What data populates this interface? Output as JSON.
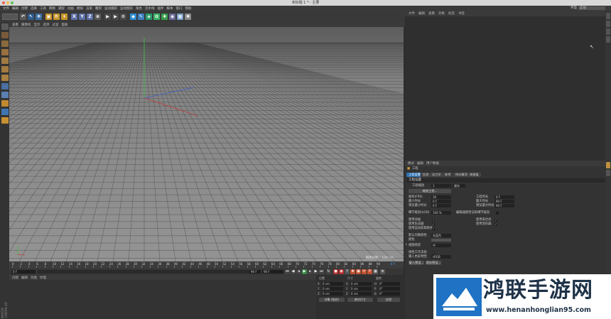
{
  "window": {
    "title": "未标题 1 * - 主要"
  },
  "menu": {
    "items": [
      "文件",
      "编辑",
      "创建",
      "选择",
      "工具",
      "网格",
      "捕捉",
      "动画",
      "模拟",
      "渲染",
      "雕刻",
      "运动跟踪",
      "运动图形",
      "角色",
      "流水线",
      "插件",
      "脚本",
      "窗口",
      "帮助"
    ],
    "layout_label": "界面",
    "layout_value": "启动"
  },
  "toolbar": {
    "buttons": [
      {
        "name": "undo-icon",
        "glyph": "↶",
        "color": "#5a5a5a"
      },
      {
        "name": "live-select-icon",
        "glyph": "↖",
        "color": "#2e5b8c"
      },
      {
        "name": "move-icon",
        "glyph": "✥",
        "color": "#3b6fa3"
      },
      {
        "name": "scale-icon",
        "glyph": "▣",
        "color": "#c7952b"
      },
      {
        "name": "rotate-icon",
        "glyph": "⟳",
        "color": "#c7952b"
      },
      {
        "name": "recent-tool-icon",
        "glyph": "+",
        "color": "#c7952b"
      },
      {
        "name": "x-axis-icon",
        "glyph": "X",
        "color": "#5c6fa6"
      },
      {
        "name": "y-axis-icon",
        "glyph": "Y",
        "color": "#5c6fa6"
      },
      {
        "name": "z-axis-icon",
        "glyph": "Z",
        "color": "#5c6fa6"
      },
      {
        "name": "coordinate-system-icon",
        "glyph": "⊕",
        "color": "#5a5a5a"
      },
      {
        "name": "render-view-icon",
        "glyph": "▶",
        "color": "#4a4a4a"
      },
      {
        "name": "render-to-picture-viewer-icon",
        "glyph": "▶",
        "color": "#4a4a4a"
      },
      {
        "name": "render-settings-icon",
        "glyph": "⚙",
        "color": "#4a4a4a"
      },
      {
        "name": "cube-icon",
        "glyph": "◆",
        "color": "#2d8fd6"
      },
      {
        "name": "pen-icon",
        "glyph": "✎",
        "color": "#3a7fc0"
      },
      {
        "name": "subdivision-icon",
        "glyph": "◈",
        "color": "#2a9c6a"
      },
      {
        "name": "array-icon",
        "glyph": "✿",
        "color": "#3db36a"
      },
      {
        "name": "deformer-icon",
        "glyph": "✚",
        "color": "#3a9c4a"
      },
      {
        "name": "environment-icon",
        "glyph": "◉",
        "color": "#6a6a9a"
      },
      {
        "name": "camera-icon",
        "glyph": "▦",
        "color": "#7ba0c8"
      },
      {
        "name": "light-icon",
        "glyph": "✺",
        "color": "#8a8a8a"
      }
    ]
  },
  "viewport": {
    "tabs": [
      "查看",
      "摄像机",
      "显示",
      "选项",
      "过滤",
      "面板"
    ],
    "grid_label": "网格间距 : 100 cm"
  },
  "timeline": {
    "ticks": [
      "0",
      "2",
      "4",
      "6",
      "8",
      "10",
      "12",
      "14",
      "16",
      "18",
      "20",
      "22",
      "24",
      "26",
      "28",
      "30",
      "32",
      "34",
      "36",
      "38",
      "40",
      "42",
      "44",
      "46",
      "48",
      "50",
      "52",
      "54",
      "56",
      "58",
      "60",
      "62",
      "64",
      "66",
      "68",
      "70",
      "72",
      "74",
      "76",
      "78",
      "80",
      "82",
      "84",
      "86",
      "88",
      "90"
    ],
    "end_label": "0 F"
  },
  "playback": {
    "current_frame": "0 F",
    "start_frame": "0 F",
    "end_field": "90 F",
    "end_field2": "90 F"
  },
  "materials": {
    "tabs": [
      "创建",
      "编辑",
      "功能",
      "纹理"
    ]
  },
  "coordinates": {
    "header": [
      "位置",
      "尺寸",
      "旋转"
    ],
    "rows": [
      {
        "axis": "X",
        "pos": "0 cm",
        "size_label": "X",
        "size": "0 cm",
        "rot_label": "H",
        "rot": "0°"
      },
      {
        "axis": "Y",
        "pos": "0 cm",
        "size_label": "Y",
        "size": "0 cm",
        "rot_label": "P",
        "rot": "0°"
      },
      {
        "axis": "Z",
        "pos": "0 cm",
        "size_label": "Z",
        "size": "0 cm",
        "rot_label": "B",
        "rot": "0°"
      }
    ],
    "mode1": "对象 (相对)",
    "mode2": "绝对尺寸",
    "apply": "应用"
  },
  "object_manager": {
    "tabs": [
      "文件",
      "编辑",
      "查看",
      "对象",
      "标签",
      "书签"
    ]
  },
  "attributes": {
    "tabs": [
      "模式",
      "编辑",
      "用户数据"
    ],
    "title": "工程",
    "subtabs": [
      "工程设置",
      "信息",
      "动力学",
      "参考",
      "待办事项",
      "帧插值"
    ],
    "section": "工程设置",
    "scale_label": "工程缩放",
    "scale_value": "1",
    "scale_unit": "厘米",
    "scale_button": "缩放工程...",
    "fps_label": "帧率(FPS)",
    "fps_value": "30",
    "time_label": "工程时长",
    "time_value": "0 F",
    "min_label": "最小时长",
    "min_value": "0 F",
    "max_label": "最大时长",
    "max_value": "90 F",
    "pmin_label": "预览最小时长",
    "pmin_value": "0 F",
    "pmax_label": "预览最大时长",
    "pmax_value": "90 F",
    "lod_label": "细节级别(LOD)",
    "lod_value": "100 %",
    "lod_render_label": "编辑器使用渲染细节级别",
    "anim_label": "使用动画",
    "expr_label": "使用表达式",
    "gen_label": "使用生成器",
    "deform_label": "使用变形器",
    "motion_label": "使用运动剪辑系统",
    "color_label": "默认对象颜色",
    "color_value": "灰蓝色",
    "color2_label": "颜色",
    "view_clip_label": "视图修剪",
    "view_clip_value": "中",
    "linear_label": "线性工作流程",
    "input_color_label": "输入色彩特性",
    "input_color_value": "sRGB",
    "load_preset": "载入预设...",
    "save_preset": "保存预设..."
  },
  "watermark": {
    "title": "鸿联手游网",
    "url": "www.henanhonglian95.com"
  },
  "brand": "MAXON CINEMA 4D"
}
